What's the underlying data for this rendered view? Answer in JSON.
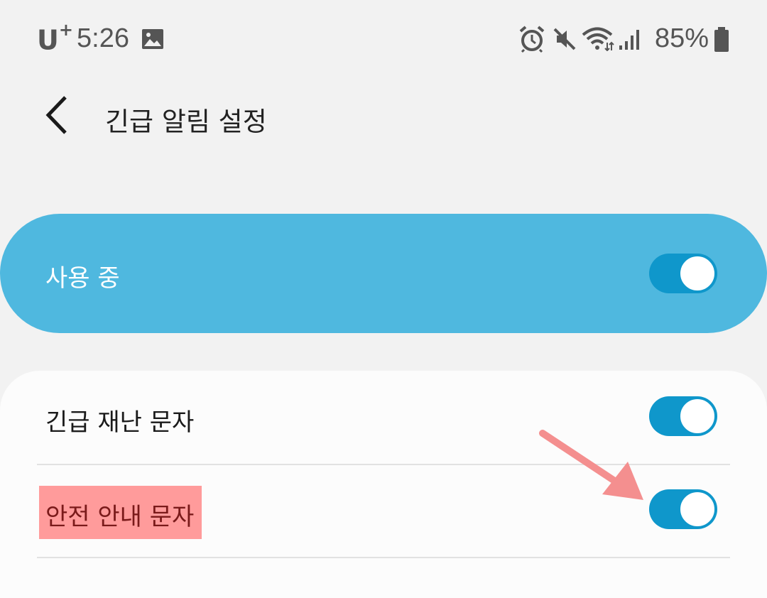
{
  "status_bar": {
    "carrier": "U",
    "carrier_plus": "+",
    "time": "5:26",
    "battery": "85%",
    "icons": [
      "gallery-icon",
      "alarm-icon",
      "mute-icon",
      "wifi-icon",
      "signal-icon",
      "battery-icon"
    ],
    "icon_color": "#555555"
  },
  "header": {
    "title": "긴급 알림 설정",
    "back_icon": "chevron-left-icon"
  },
  "master": {
    "label": "사용 중",
    "enabled": true,
    "bg_color": "#4fb8df"
  },
  "settings": [
    {
      "label": "긴급 재난 문자",
      "enabled": true
    },
    {
      "label": "안전 안내 문자",
      "enabled": true
    }
  ],
  "annotation": {
    "arrow_color": "#f48f8f",
    "highlight_color": "#ff9696"
  },
  "accent": "#0f97cb"
}
